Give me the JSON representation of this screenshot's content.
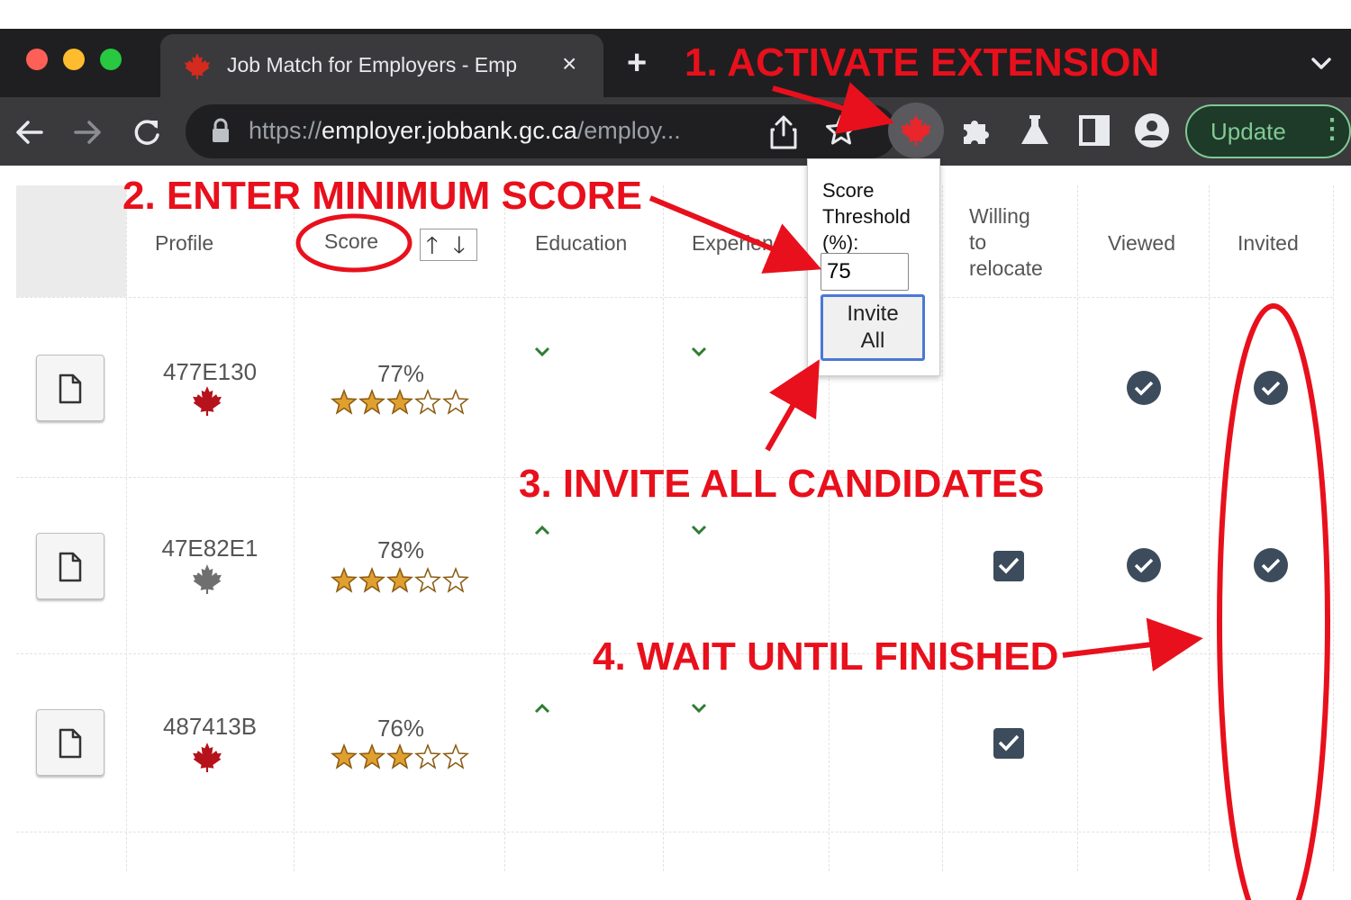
{
  "browser": {
    "tab_title": "Job Match for Employers - Emp",
    "tab_close": "×",
    "new_tab": "+",
    "url_scheme": "https://",
    "url_host": "employer.jobbank.gc.ca",
    "url_path": "/employ...",
    "update_label": "Update",
    "update_menu": "⋮",
    "icons": [
      "maple-leaf-icon",
      "back-arrow-icon",
      "forward-arrow-icon",
      "reload-icon",
      "lock-icon",
      "share-icon",
      "bookmark-star-icon",
      "puzzle-icon",
      "flask-icon",
      "sidepanel-icon",
      "profile-icon",
      "chevron-down-icon"
    ]
  },
  "table": {
    "headers": {
      "profile": "Profile",
      "score": "Score",
      "education": "Education",
      "experience": "Experience",
      "willing_line1": "Willing",
      "willing_line2": "to",
      "willing_line3": "relocate",
      "viewed": "Viewed",
      "invited": "Invited"
    },
    "sort_up": "🡑",
    "sort_down": "🡓",
    "rows": [
      {
        "id": "477E130",
        "score": "77%",
        "stars": 3,
        "leaf_color": "#b5121b",
        "education": "down",
        "experience": "down",
        "willing": false,
        "viewed": true,
        "invited": true
      },
      {
        "id": "47E82E1",
        "score": "78%",
        "stars": 3,
        "leaf_color": "#6f6f6f",
        "education": "up",
        "experience": "down",
        "willing": true,
        "viewed": true,
        "invited": true
      },
      {
        "id": "487413B",
        "score": "76%",
        "stars": 3,
        "leaf_color": "#b5121b",
        "education": "up",
        "experience": "down",
        "willing": true,
        "viewed": false,
        "invited": false
      }
    ]
  },
  "popup": {
    "label_line1": "Score",
    "label_line2": "Threshold",
    "label_line3": "(%):",
    "threshold_value": "75",
    "invite_line1": "Invite",
    "invite_line2": "All"
  },
  "annotations": {
    "step1": "1. ACTIVATE EXTENSION",
    "step2": "2. ENTER MINIMUM SCORE",
    "step3": "3. INVITE ALL CANDIDATES",
    "step4": "4. WAIT UNTIL FINISHED",
    "color": "#e8101c"
  },
  "colors": {
    "accent_red": "#e8101c",
    "check_dark": "#3d4c5c",
    "chevron_green": "#2e7d32",
    "star_gold": "#e0a030",
    "update_green": "#81c995"
  }
}
